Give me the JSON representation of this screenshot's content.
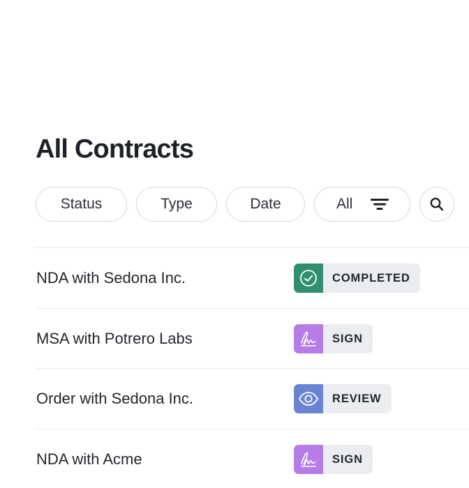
{
  "page": {
    "title": "All Contracts"
  },
  "filters": {
    "status_label": "Status",
    "type_label": "Type",
    "date_label": "Date",
    "all_label": "All",
    "filter_icon": "filter-lines-icon",
    "search_icon": "search-icon"
  },
  "contracts": [
    {
      "name": "NDA with Sedona Inc.",
      "status": "COMPLETED",
      "icon": "check-circle-icon",
      "color": "#2f8f6e"
    },
    {
      "name": "MSA with Potrero Labs",
      "status": "SIGN",
      "icon": "signature-icon",
      "color": "#b77de6"
    },
    {
      "name": "Order with Sedona Inc.",
      "status": "REVIEW",
      "icon": "eye-icon",
      "color": "#6b84d2"
    },
    {
      "name": "NDA with Acme",
      "status": "SIGN",
      "icon": "signature-icon",
      "color": "#b77de6"
    }
  ]
}
